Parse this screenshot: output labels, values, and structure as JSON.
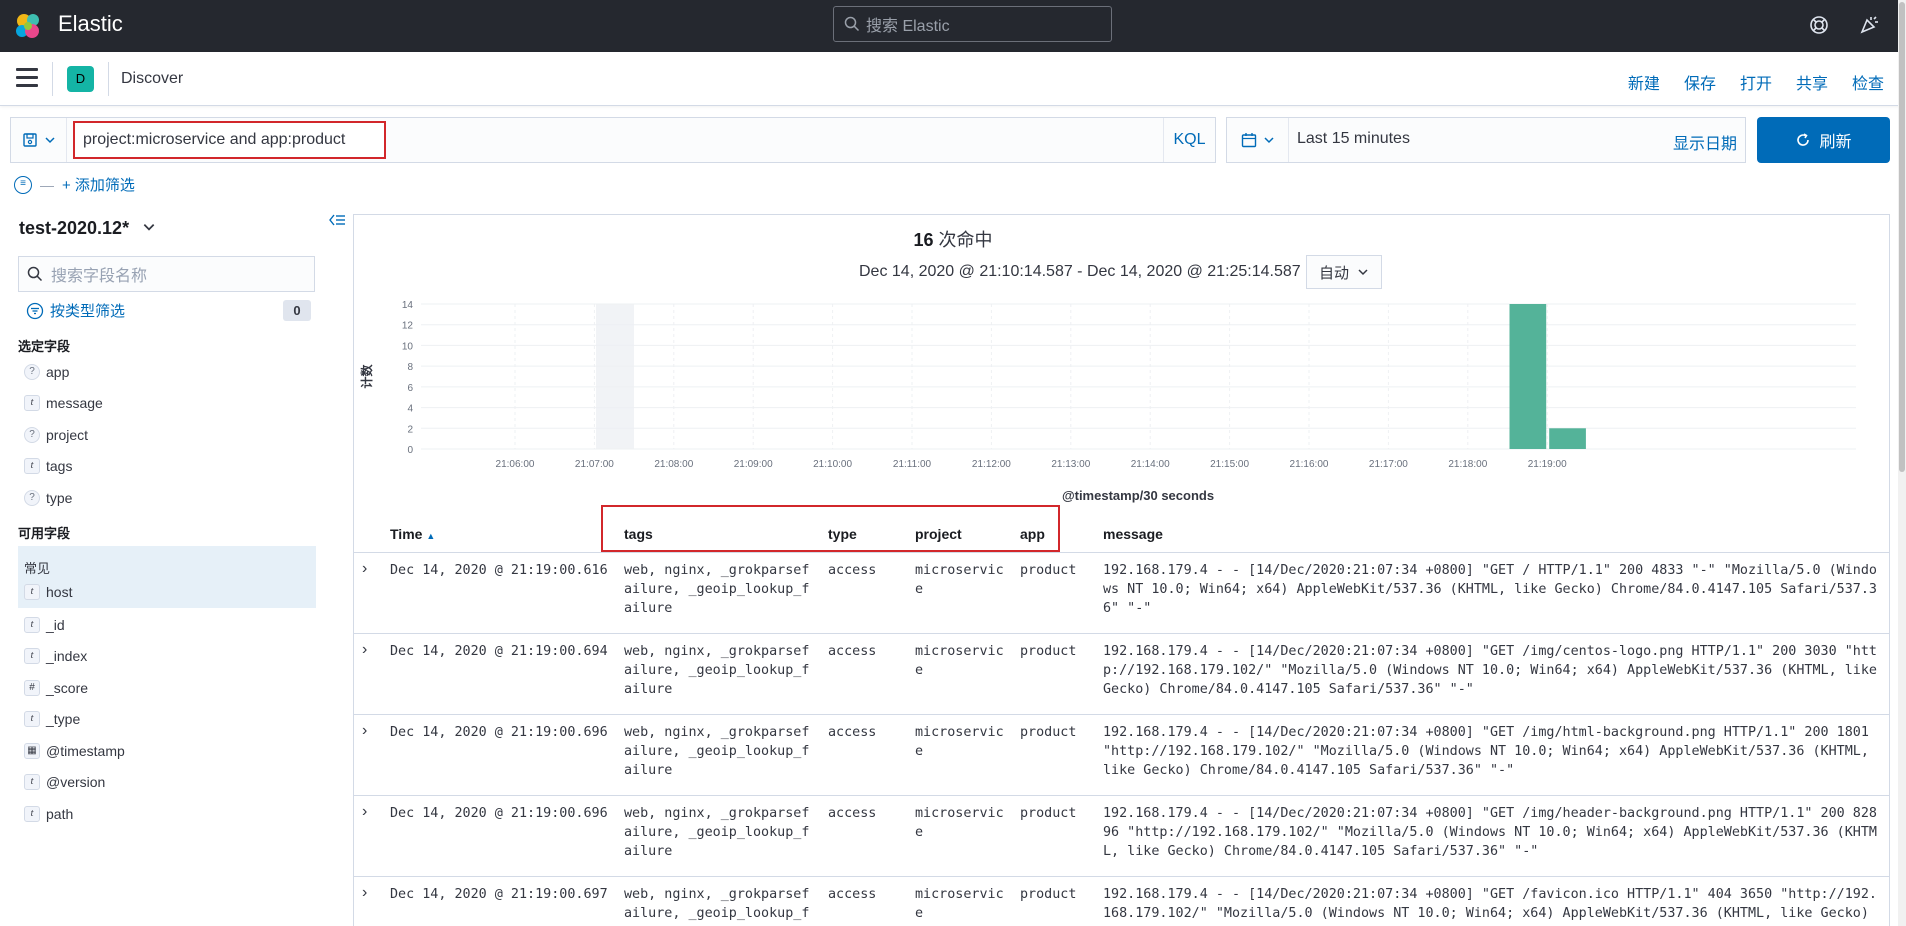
{
  "topbar": {
    "brand": "Elastic",
    "search_placeholder": "搜索 Elastic"
  },
  "subbar": {
    "app_badge": "D",
    "app_title": "Discover",
    "links": [
      "新建",
      "保存",
      "打开",
      "共享",
      "检查"
    ]
  },
  "query": {
    "value": "project:microservice and app:product",
    "language": "KQL",
    "date_range": "Last 15 minutes",
    "show_dates": "显示日期",
    "refresh": "刷新",
    "add_filter": "+ 添加筛选"
  },
  "sidebar": {
    "index_pattern": "test-2020.12*",
    "field_search_placeholder": "搜索字段名称",
    "type_filter_label": "按类型筛选",
    "type_filter_count": "0",
    "selected_title": "选定字段",
    "selected_fields": [
      {
        "type": "?",
        "name": "app"
      },
      {
        "type": "t",
        "name": "message"
      },
      {
        "type": "?",
        "name": "project"
      },
      {
        "type": "t",
        "name": "tags"
      },
      {
        "type": "?",
        "name": "type"
      }
    ],
    "available_title": "可用字段",
    "common_label": "常见",
    "available_fields": [
      {
        "type": "t",
        "name": "host"
      },
      {
        "type": "t",
        "name": "_id"
      },
      {
        "type": "t",
        "name": "_index"
      },
      {
        "type": "#",
        "name": "_score"
      },
      {
        "type": "t",
        "name": "_type"
      },
      {
        "type": "cal",
        "name": "@timestamp"
      },
      {
        "type": "t",
        "name": "@version"
      },
      {
        "type": "t",
        "name": "path"
      }
    ]
  },
  "summary": {
    "hits_count": "16",
    "hits_suffix": " 次命中",
    "time_range": "Dec 14, 2020 @ 21:10:14.587 - Dec 14, 2020 @ 21:25:14.587",
    "interval": "自动"
  },
  "chart_data": {
    "type": "bar",
    "ylabel": "计数",
    "xlabel": "@timestamp/30 seconds",
    "ylim": [
      0,
      14
    ],
    "yticks": [
      0,
      2,
      4,
      6,
      8,
      10,
      12,
      14
    ],
    "xticks": [
      "21:06:00",
      "21:07:00",
      "21:08:00",
      "21:09:00",
      "21:10:00",
      "21:11:00",
      "21:12:00",
      "21:13:00",
      "21:14:00",
      "21:15:00",
      "21:16:00",
      "21:17:00",
      "21:18:00",
      "21:19:00"
    ],
    "bars": [
      {
        "x": "21:19:00",
        "value": 14
      },
      {
        "x": "21:19:30",
        "value": 2
      }
    ],
    "bar_color": "#54b399"
  },
  "table": {
    "headers": {
      "time": "Time",
      "tags": "tags",
      "type": "type",
      "project": "project",
      "app": "app",
      "message": "message"
    },
    "rows": [
      {
        "time": "Dec 14, 2020 @ 21:19:00.616",
        "tags": "web, nginx, _grokparsefailure, _geoip_lookup_failure",
        "type": "access",
        "project": "microservice",
        "app": "product",
        "message": "192.168.179.4 - - [14/Dec/2020:21:07:34 +0800] \"GET / HTTP/1.1\" 200 4833 \"-\" \"Mozilla/5.0 (Windows NT 10.0; Win64; x64) AppleWebKit/537.36 (KHTML, like Gecko) Chrome/84.0.4147.105 Safari/537.36\" \"-\""
      },
      {
        "time": "Dec 14, 2020 @ 21:19:00.694",
        "tags": "web, nginx, _grokparsefailure, _geoip_lookup_failure",
        "type": "access",
        "project": "microservice",
        "app": "product",
        "message": "192.168.179.4 - - [14/Dec/2020:21:07:34 +0800] \"GET /img/centos-logo.png HTTP/1.1\" 200 3030 \"http://192.168.179.102/\" \"Mozilla/5.0 (Windows NT 10.0; Win64; x64) AppleWebKit/537.36 (KHTML, like Gecko) Chrome/84.0.4147.105 Safari/537.36\" \"-\""
      },
      {
        "time": "Dec 14, 2020 @ 21:19:00.696",
        "tags": "web, nginx, _grokparsefailure, _geoip_lookup_failure",
        "type": "access",
        "project": "microservice",
        "app": "product",
        "message": "192.168.179.4 - - [14/Dec/2020:21:07:34 +0800] \"GET /img/html-background.png HTTP/1.1\" 200 1801 \"http://192.168.179.102/\" \"Mozilla/5.0 (Windows NT 10.0; Win64; x64) AppleWebKit/537.36 (KHTML, like Gecko) Chrome/84.0.4147.105 Safari/537.36\" \"-\""
      },
      {
        "time": "Dec 14, 2020 @ 21:19:00.696",
        "tags": "web, nginx, _grokparsefailure, _geoip_lookup_failure",
        "type": "access",
        "project": "microservice",
        "app": "product",
        "message": "192.168.179.4 - - [14/Dec/2020:21:07:34 +0800] \"GET /img/header-background.png HTTP/1.1\" 200 82896 \"http://192.168.179.102/\" \"Mozilla/5.0 (Windows NT 10.0; Win64; x64) AppleWebKit/537.36 (KHTML, like Gecko) Chrome/84.0.4147.105 Safari/537.36\" \"-\""
      },
      {
        "time": "Dec 14, 2020 @ 21:19:00.697",
        "tags": "web, nginx, _grokparsefailure, _geoip_lookup_failure",
        "type": "access",
        "project": "microservice",
        "app": "product",
        "message": "192.168.179.4 - - [14/Dec/2020:21:07:34 +0800] \"GET /favicon.ico HTTP/1.1\" 404 3650 \"http://192.168.179.102/\" \"Mozilla/5.0 (Windows NT 10.0; Win64; x64) AppleWebKit/537.36 (KHTML, like Gecko)"
      }
    ]
  }
}
